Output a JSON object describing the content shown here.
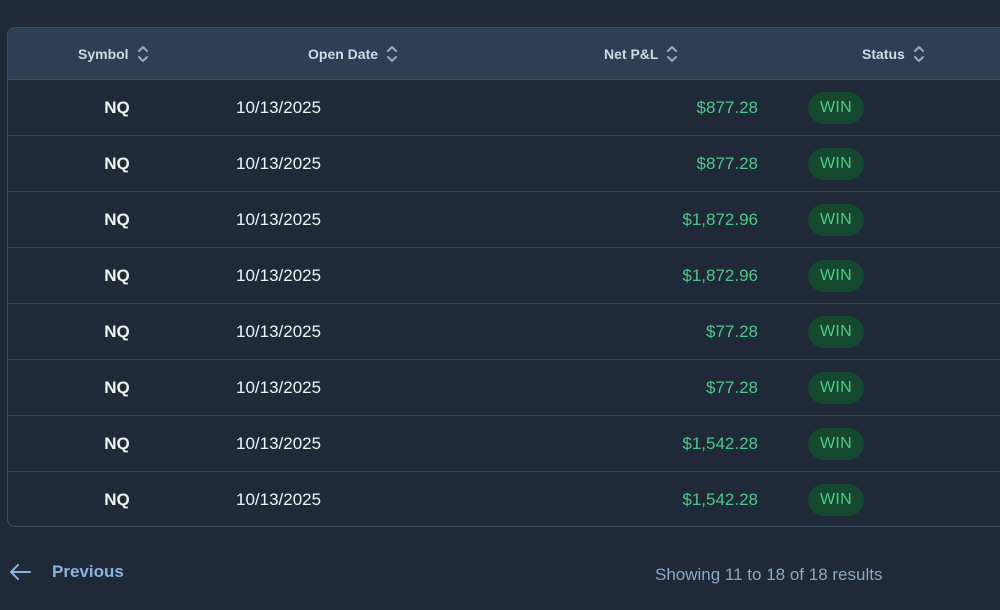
{
  "table": {
    "headers": {
      "symbol": "Symbol",
      "open_date": "Open Date",
      "net_pnl": "Net P&L",
      "status": "Status"
    },
    "rows": [
      {
        "symbol": "NQ",
        "open_date": "10/13/2025",
        "net_pnl": "$877.28",
        "status": "WIN"
      },
      {
        "symbol": "NQ",
        "open_date": "10/13/2025",
        "net_pnl": "$877.28",
        "status": "WIN"
      },
      {
        "symbol": "NQ",
        "open_date": "10/13/2025",
        "net_pnl": "$1,872.96",
        "status": "WIN"
      },
      {
        "symbol": "NQ",
        "open_date": "10/13/2025",
        "net_pnl": "$1,872.96",
        "status": "WIN"
      },
      {
        "symbol": "NQ",
        "open_date": "10/13/2025",
        "net_pnl": "$77.28",
        "status": "WIN"
      },
      {
        "symbol": "NQ",
        "open_date": "10/13/2025",
        "net_pnl": "$77.28",
        "status": "WIN"
      },
      {
        "symbol": "NQ",
        "open_date": "10/13/2025",
        "net_pnl": "$1,542.28",
        "status": "WIN"
      },
      {
        "symbol": "NQ",
        "open_date": "10/13/2025",
        "net_pnl": "$1,542.28",
        "status": "WIN"
      }
    ]
  },
  "pagination": {
    "previous_label": "Previous",
    "summary": "Showing 11 to 18 of 18 results"
  },
  "icons": {
    "sort": "sort-icon",
    "previous": "arrow-left-icon"
  },
  "colors": {
    "background": "#1f2937",
    "header_bg": "#2e3e54",
    "border": "#3c4d63",
    "profit": "#4fc98a",
    "win_badge_bg": "#14482f",
    "link": "#8bb3e0"
  }
}
